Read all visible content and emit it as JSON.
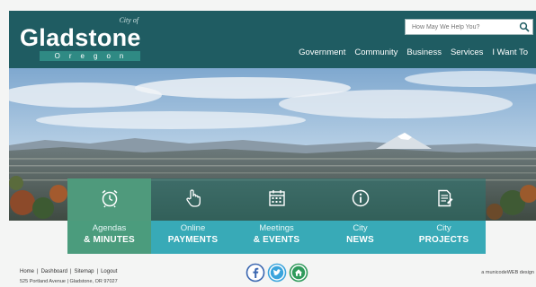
{
  "header": {
    "city_of": "City of",
    "logo_name": "Gladstone",
    "logo_state": "Oregon",
    "search_placeholder": "How May We Help You?",
    "search_icon": "search-icon",
    "nav": [
      "Government",
      "Community",
      "Business",
      "Services",
      "I Want To"
    ]
  },
  "tiles": [
    {
      "line1": "Agendas",
      "line2": "& MINUTES",
      "icon": "alarm-clock-icon"
    },
    {
      "line1": "Online",
      "line2": "PAYMENTS",
      "icon": "hand-pointer-icon"
    },
    {
      "line1": "Meetings",
      "line2": "& EVENTS",
      "icon": "calendar-icon"
    },
    {
      "line1": "City",
      "line2": "NEWS",
      "icon": "info-icon"
    },
    {
      "line1": "City",
      "line2": "PROJECTS",
      "icon": "document-icon"
    }
  ],
  "footer": {
    "links": [
      "Home",
      "Dashboard",
      "Sitemap",
      "Logout"
    ],
    "address": "525 Portland Avenue | Gladstone, OR 97027",
    "credit": "a municodeWEB design",
    "social": [
      "facebook-icon",
      "twitter-icon",
      "nextdoor-icon"
    ]
  },
  "colors": {
    "header_bg": "#1f5c62",
    "tile_teal": "#38aab7",
    "tile_active": "#4b9c7d"
  }
}
